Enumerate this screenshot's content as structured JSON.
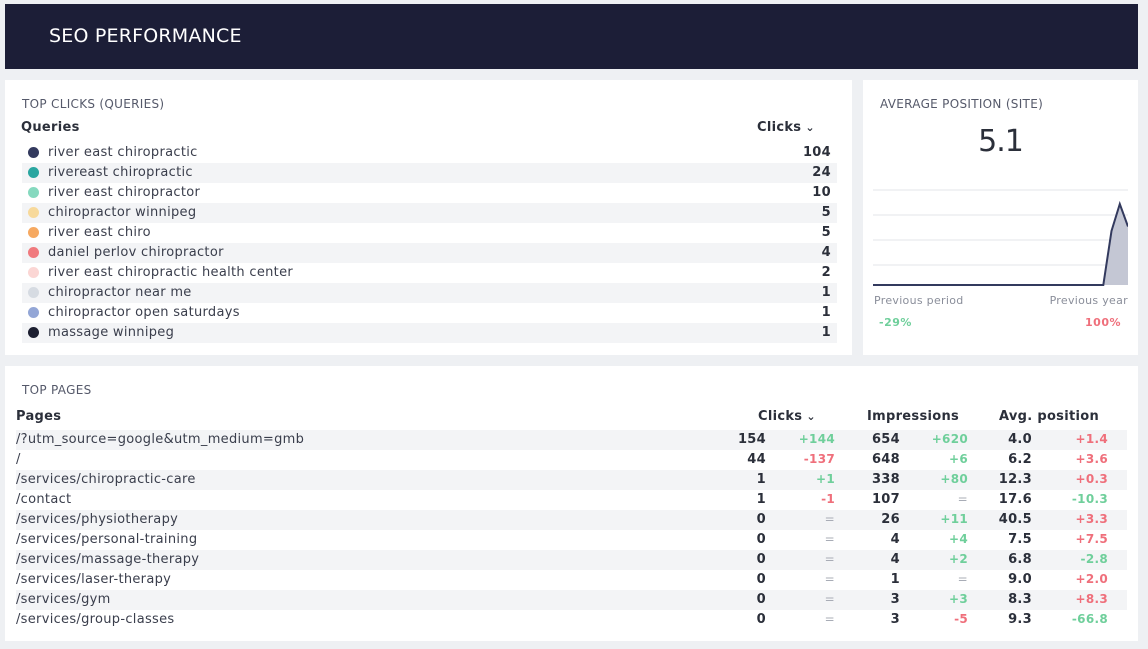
{
  "header": {
    "title": "SEO PERFORMANCE"
  },
  "queries": {
    "title": "TOP CLICKS (QUERIES)",
    "col_query": "Queries",
    "col_clicks": "Clicks",
    "rows": [
      {
        "label": "river east chiropractic",
        "value": "104",
        "color": "#333a5e"
      },
      {
        "label": "rivereast chiropractic",
        "value": "24",
        "color": "#2aa6a0"
      },
      {
        "label": "river east chiropractor",
        "value": "10",
        "color": "#86d9bf"
      },
      {
        "label": "chiropractor winnipeg",
        "value": "5",
        "color": "#f7d99b"
      },
      {
        "label": "river east chiro",
        "value": "5",
        "color": "#f6a961"
      },
      {
        "label": "daniel perlov chiropractor",
        "value": "4",
        "color": "#f07a7e"
      },
      {
        "label": "river east chiropractic health center",
        "value": "2",
        "color": "#fbd6d4"
      },
      {
        "label": "chiropractor near me",
        "value": "1",
        "color": "#d6dbe2"
      },
      {
        "label": "chiropractor open saturdays",
        "value": "1",
        "color": "#93a6d6"
      },
      {
        "label": "massage winnipeg",
        "value": "1",
        "color": "#1c1e30"
      }
    ]
  },
  "avg_position": {
    "title": "AVERAGE POSITION (SITE)",
    "value": "5.1",
    "previous_period_label": "Previous period",
    "previous_period_change": "-29%",
    "previous_year_label": "Previous year",
    "previous_year_change": "100%",
    "sparkline": [
      0,
      0,
      0,
      0,
      0,
      0,
      0,
      0,
      0,
      0,
      0,
      0,
      0,
      0,
      0,
      0,
      0,
      0,
      0,
      0,
      0,
      0,
      0,
      0,
      0,
      0,
      0,
      0,
      0,
      0.6,
      0.9,
      0.65
    ],
    "colors": {
      "positive": "#6fcf9b",
      "negative": "#ef6f7b",
      "line": "#333a5e",
      "fill": "#c4c7d4"
    }
  },
  "pages": {
    "title": "TOP PAGES",
    "col_page": "Pages",
    "col_clicks": "Clicks",
    "col_impressions": "Impressions",
    "col_position": "Avg. position",
    "rows": [
      {
        "page": "/?utm_source=google&utm_medium=gmb",
        "clicks": "154",
        "clicks_delta": "+144",
        "clicks_dir": "pos",
        "impr": "654",
        "impr_delta": "+620",
        "impr_dir": "pos",
        "pos": "4.0",
        "pos_delta": "+1.4",
        "pos_dir": "neg"
      },
      {
        "page": "/",
        "clicks": "44",
        "clicks_delta": "-137",
        "clicks_dir": "neg",
        "impr": "648",
        "impr_delta": "+6",
        "impr_dir": "pos",
        "pos": "6.2",
        "pos_delta": "+3.6",
        "pos_dir": "neg"
      },
      {
        "page": "/services/chiropractic-care",
        "clicks": "1",
        "clicks_delta": "+1",
        "clicks_dir": "pos",
        "impr": "338",
        "impr_delta": "+80",
        "impr_dir": "pos",
        "pos": "12.3",
        "pos_delta": "+0.3",
        "pos_dir": "neg"
      },
      {
        "page": "/contact",
        "clicks": "1",
        "clicks_delta": "-1",
        "clicks_dir": "neg",
        "impr": "107",
        "impr_delta": "=",
        "impr_dir": "neu",
        "pos": "17.6",
        "pos_delta": "-10.3",
        "pos_dir": "pos"
      },
      {
        "page": "/services/physiotherapy",
        "clicks": "0",
        "clicks_delta": "=",
        "clicks_dir": "neu",
        "impr": "26",
        "impr_delta": "+11",
        "impr_dir": "pos",
        "pos": "40.5",
        "pos_delta": "+3.3",
        "pos_dir": "neg"
      },
      {
        "page": "/services/personal-training",
        "clicks": "0",
        "clicks_delta": "=",
        "clicks_dir": "neu",
        "impr": "4",
        "impr_delta": "+4",
        "impr_dir": "pos",
        "pos": "7.5",
        "pos_delta": "+7.5",
        "pos_dir": "neg"
      },
      {
        "page": "/services/massage-therapy",
        "clicks": "0",
        "clicks_delta": "=",
        "clicks_dir": "neu",
        "impr": "4",
        "impr_delta": "+2",
        "impr_dir": "pos",
        "pos": "6.8",
        "pos_delta": "-2.8",
        "pos_dir": "pos"
      },
      {
        "page": "/services/laser-therapy",
        "clicks": "0",
        "clicks_delta": "=",
        "clicks_dir": "neu",
        "impr": "1",
        "impr_delta": "=",
        "impr_dir": "neu",
        "pos": "9.0",
        "pos_delta": "+2.0",
        "pos_dir": "neg"
      },
      {
        "page": "/services/gym",
        "clicks": "0",
        "clicks_delta": "=",
        "clicks_dir": "neu",
        "impr": "3",
        "impr_delta": "+3",
        "impr_dir": "pos",
        "pos": "8.3",
        "pos_delta": "+8.3",
        "pos_dir": "neg"
      },
      {
        "page": "/services/group-classes",
        "clicks": "0",
        "clicks_delta": "=",
        "clicks_dir": "neu",
        "impr": "3",
        "impr_delta": "-5",
        "impr_dir": "neg",
        "pos": "9.3",
        "pos_delta": "-66.8",
        "pos_dir": "pos"
      }
    ]
  }
}
